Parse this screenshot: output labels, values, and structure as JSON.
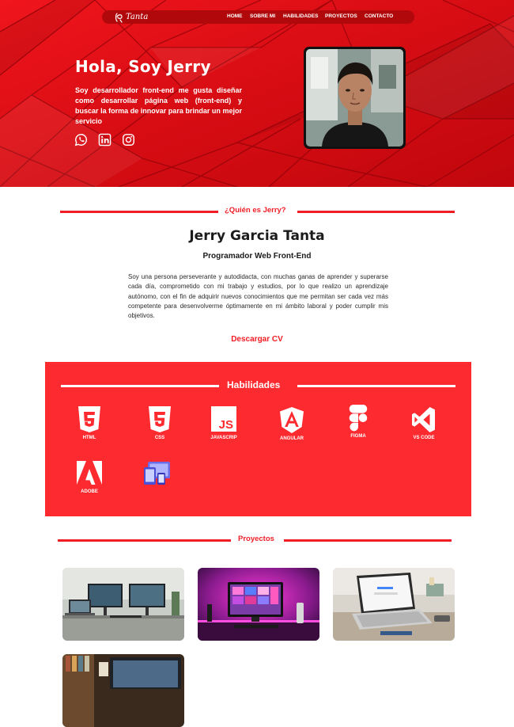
{
  "brand": {
    "logo_text": "Tanta",
    "logo_icon": "code-signature-icon"
  },
  "nav": [
    {
      "label": "HOME"
    },
    {
      "label": "SOBRE MI"
    },
    {
      "label": "HABILIDADES"
    },
    {
      "label": "PROYECTOS"
    },
    {
      "label": "CONTACTO"
    }
  ],
  "hero": {
    "title": "Hola, Soy Jerry",
    "description": "Soy desarrollador front-end me gusta diseñar como desarrollar página web (front-end) y buscar la forma de innovar para brindar un mejor servicio",
    "social": [
      {
        "icon": "whatsapp-icon"
      },
      {
        "icon": "linkedin-icon"
      },
      {
        "icon": "instagram-icon"
      }
    ]
  },
  "about": {
    "heading": "¿Quién es Jerry?",
    "name": "Jerry Garcia Tanta",
    "role": "Programador Web Front-End",
    "text": "Soy una persona perseverante y autodidacta, con muchas ganas de aprender y superarse cada día, comprometido con mi trabajo y estudios, por lo que realizo un aprendizaje autónomo, con el fin de adquirir nuevos conocimientos que me permitan ser cada vez más competente para desenvolverme óptimamente en mi ámbito laboral y poder cumplir mis objetivos.",
    "cv_label": "Descargar CV"
  },
  "skills": {
    "heading": "Habilidades",
    "items": [
      {
        "label": "HTML",
        "icon": "html5-icon"
      },
      {
        "label": "CSS",
        "icon": "css3-icon"
      },
      {
        "label": "JAVASCRIP",
        "icon": "javascript-icon"
      },
      {
        "label": "ANGULAR",
        "icon": "angular-icon"
      },
      {
        "label": "FIGMA",
        "icon": "figma-icon"
      },
      {
        "label": "VS CODE",
        "icon": "vscode-icon"
      },
      {
        "label": "ADOBE",
        "icon": "adobe-icon"
      },
      {
        "label": "",
        "icon": "responsive-devices-icon"
      }
    ]
  },
  "projects": {
    "heading": "Proyectos",
    "items": [
      {
        "image": "project-desk-monitors-thumbnail"
      },
      {
        "image": "project-neon-setup-thumbnail"
      },
      {
        "image": "project-laptop-google-thumbnail"
      },
      {
        "image": "project-laptop-books-thumbnail"
      }
    ]
  },
  "colors": {
    "accent": "#f11d25",
    "hero_red": "#d90d14",
    "skills_bg": "#fd2a2f",
    "nav_bg": "#b1080c"
  }
}
